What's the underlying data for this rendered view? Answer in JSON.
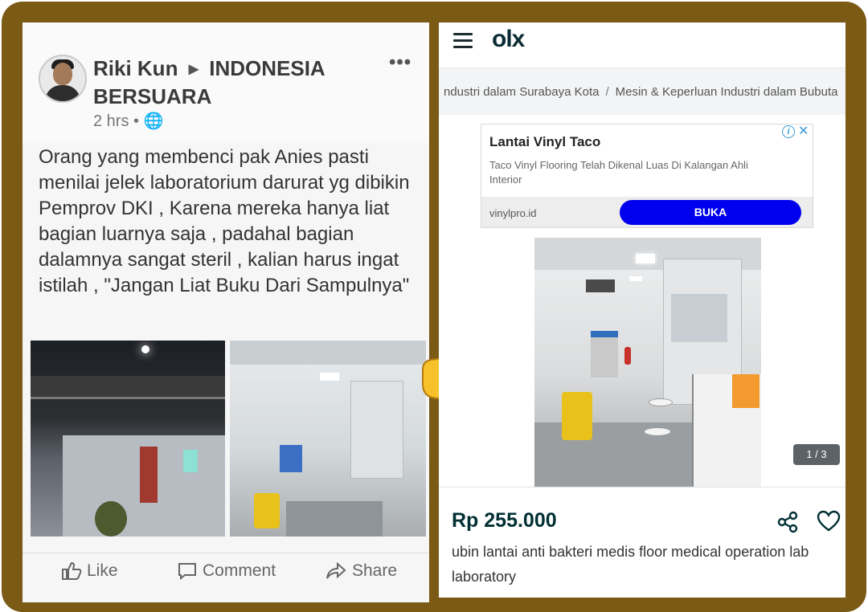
{
  "facebook_post": {
    "author": "Riki Kun",
    "group": "INDONESIA BERSUARA",
    "timestamp": "2 hrs",
    "more_label": "•••",
    "body": "Orang yang membenci pak Anies pasti menilai jelek laboratorium darurat yg dibikin Pemprov DKI , Karena mereka hanya liat bagian luarnya saja , padahal bagian dalamnya sangat steril , kalian harus ingat istilah , \"Jangan Liat Buku Dari Sampulnya\"",
    "actions": {
      "like": "Like",
      "comment": "Comment",
      "share": "Share"
    }
  },
  "olx_listing": {
    "logo": "olx",
    "breadcrumb": [
      "ndustri dalam Surabaya Kota",
      "Mesin & Keperluan Industri dalam Bubuta"
    ],
    "ad": {
      "title": "Lantai Vinyl Taco",
      "description": "Taco Vinyl Flooring Telah Dikenal Luas Di Kalangan Ahli Interior",
      "domain": "vinylpro.id",
      "button_label": "BUKA"
    },
    "photo_counter": "1 / 3",
    "price": "Rp 255.000",
    "title": "ubin lantai anti bakteri medis floor medical operation lab laboratory"
  },
  "icons": [
    "globe-icon",
    "like-icon",
    "comment-icon",
    "share-arrow-icon",
    "menu-icon",
    "ad-info-icon",
    "ad-close-icon",
    "share-icon",
    "heart-icon",
    "pointing-hand-icon"
  ],
  "colors": {
    "frame": "#7a5a14",
    "olx_brand": "#002f34",
    "ad_button": "#0000ee"
  }
}
